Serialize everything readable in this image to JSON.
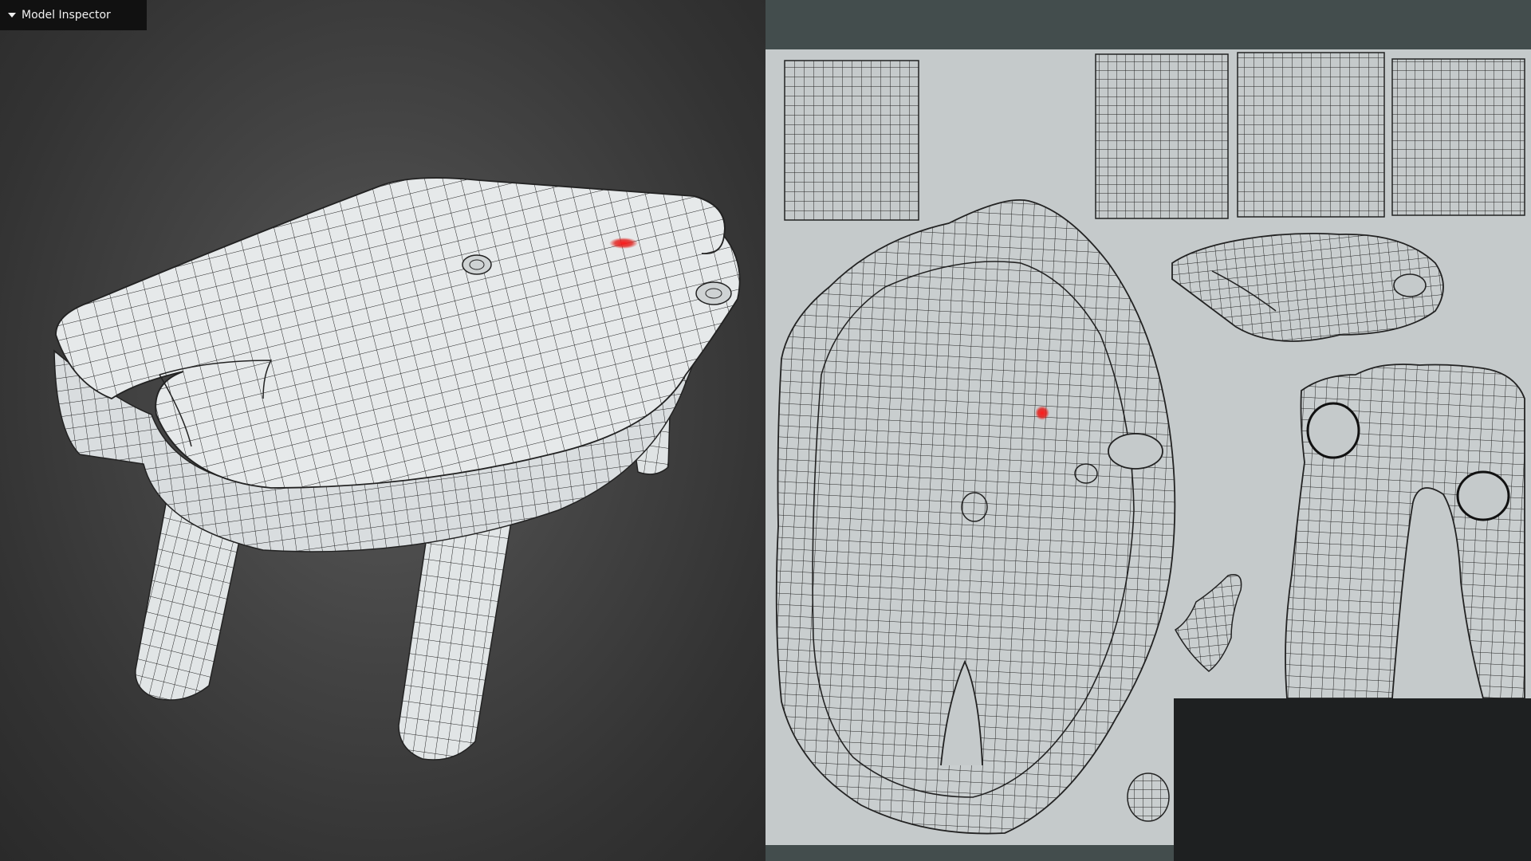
{
  "window": {
    "panel_title": "Model Inspector"
  },
  "viewport3d": {
    "model": "stool",
    "marker_color": "#e0201c"
  },
  "uv_editor": {
    "sheet_color": "#c5cacb",
    "frame_color": "#434d4d",
    "marker_color": "#e0201c"
  },
  "icons": {
    "collapse": "caret-down-icon"
  }
}
